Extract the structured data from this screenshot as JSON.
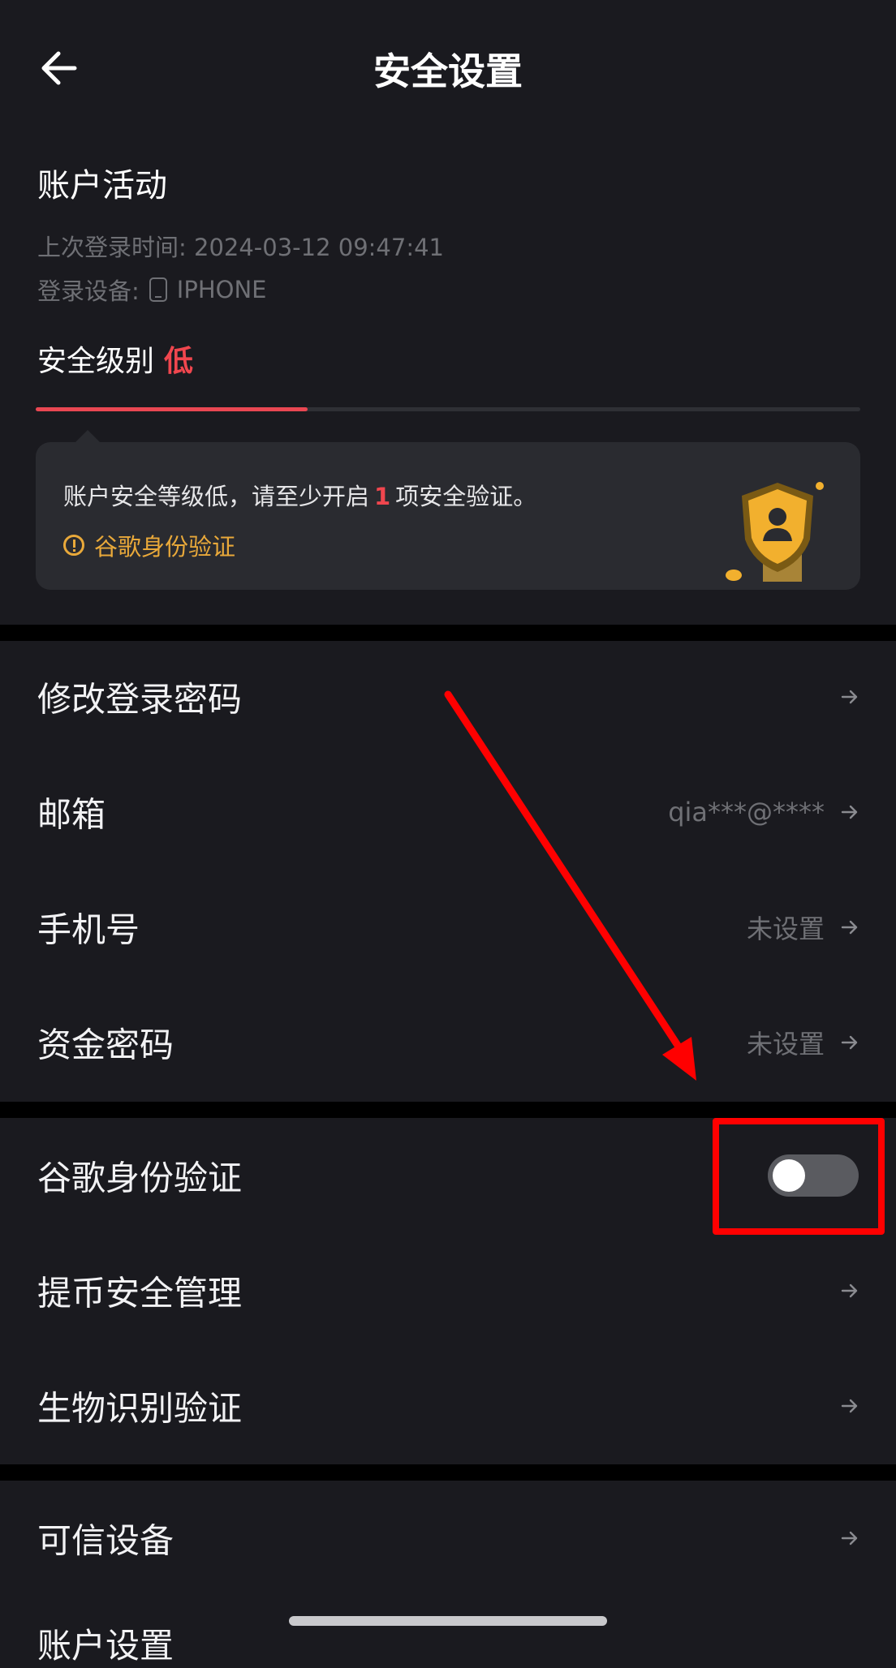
{
  "header": {
    "title": "安全设置",
    "back_icon": "arrow-left-icon"
  },
  "account_activity": {
    "title": "账户活动",
    "last_login_label": "上次登录时间:",
    "last_login_time": "2024-03-12 09:47:41",
    "device_label": "登录设备:",
    "device_icon": "phone-icon",
    "device_name": "IPHONE"
  },
  "security_level": {
    "label": "安全级别",
    "value": "低",
    "progress_fraction": 0.33,
    "value_color": "#f0464e"
  },
  "notice_card": {
    "text_before": "账户安全等级低，请至少开启",
    "count": "1",
    "text_after": "项安全验证。",
    "link_text": "谷歌身份验证",
    "link_color": "#e9a93a",
    "illustration": "shield-user-icon"
  },
  "group1": [
    {
      "label": "修改登录密码",
      "value": ""
    },
    {
      "label": "邮箱",
      "value": "qia***@****"
    },
    {
      "label": "手机号",
      "value": "未设置"
    },
    {
      "label": "资金密码",
      "value": "未设置"
    }
  ],
  "group2": {
    "google_auth": {
      "label": "谷歌身份验证",
      "enabled": false
    },
    "withdraw": {
      "label": "提币安全管理"
    },
    "biometric": {
      "label": "生物识别验证"
    }
  },
  "group3": [
    {
      "label": "可信设备"
    },
    {
      "label": "账户设置"
    }
  ],
  "annotation": {
    "color": "#ff0000"
  }
}
